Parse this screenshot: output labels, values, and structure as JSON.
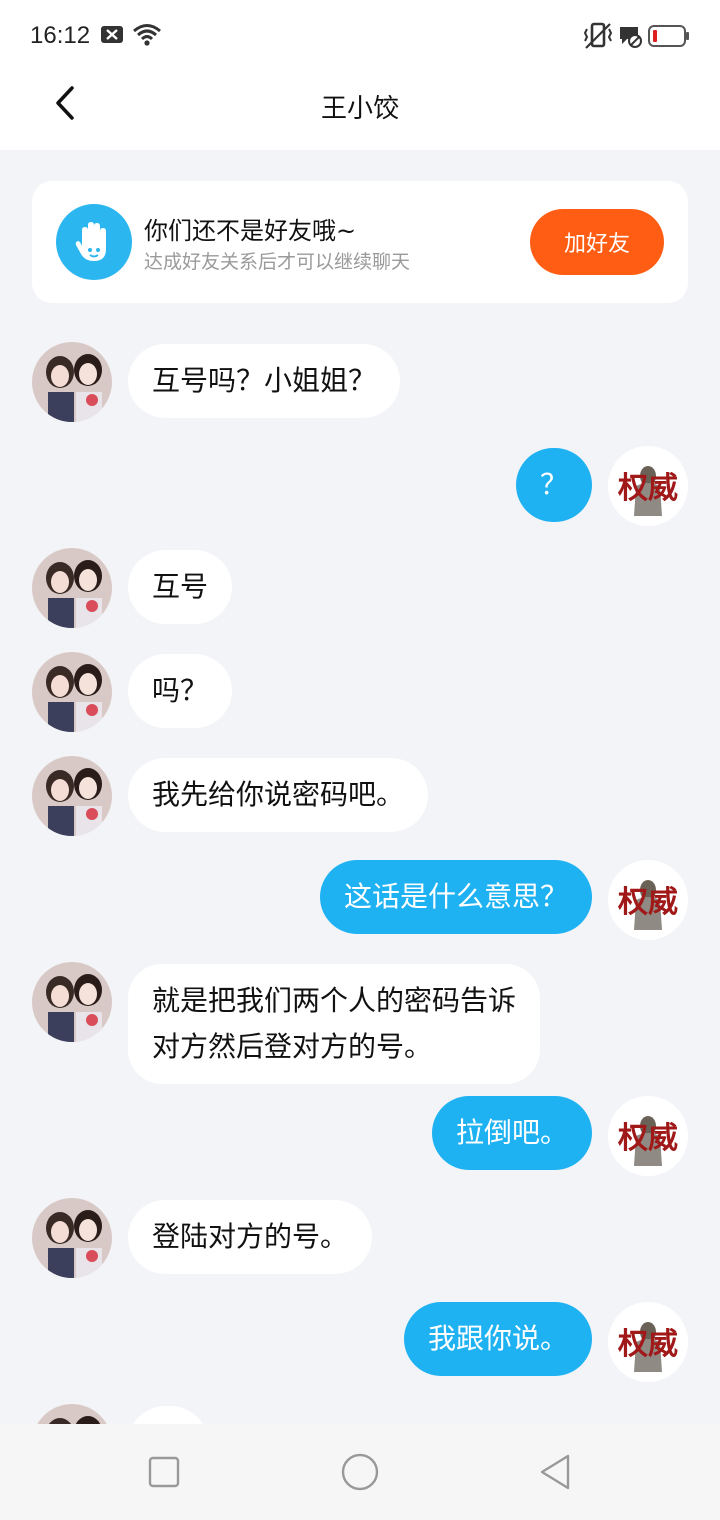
{
  "status_bar": {
    "time": "16:12",
    "icons": [
      "notification-x-icon",
      "wifi-icon",
      "vibrate-icon",
      "sms-icon",
      "battery-icon"
    ],
    "battery_color": "#e02020"
  },
  "header": {
    "title": "王小饺",
    "back_icon": "chevron-left-icon"
  },
  "friend_card": {
    "icon": "hand-wave-icon",
    "title": "你们还不是好友哦~",
    "subtitle": "达成好友关系后才可以继续聊天",
    "button_label": "加好友",
    "button_color": "#ff5d13"
  },
  "messages": [
    {
      "side": "left",
      "text": "互号吗？小姐姐？"
    },
    {
      "side": "right",
      "text": "？"
    },
    {
      "side": "left",
      "text": "互号"
    },
    {
      "side": "left",
      "text": "吗？"
    },
    {
      "side": "left",
      "text": "我先给你说密码吧。"
    },
    {
      "side": "right",
      "text": "这话是什么意思？"
    },
    {
      "side": "left",
      "text_line1": "就是把我们两个人的密码告诉",
      "text_line2": "对方然后登对方的号。"
    },
    {
      "side": "right",
      "text": "拉倒吧。"
    },
    {
      "side": "left",
      "text": "登陆对方的号。"
    },
    {
      "side": "right",
      "text": "我跟你说。"
    }
  ],
  "avatars": {
    "right_text": "权威"
  },
  "nav_bar": {
    "buttons": [
      "recent-apps-icon",
      "home-icon",
      "back-icon"
    ]
  },
  "colors": {
    "bubble_sent": "#1fb2f3",
    "bubble_received": "#ffffff",
    "chat_background": "#f2f4f7"
  }
}
